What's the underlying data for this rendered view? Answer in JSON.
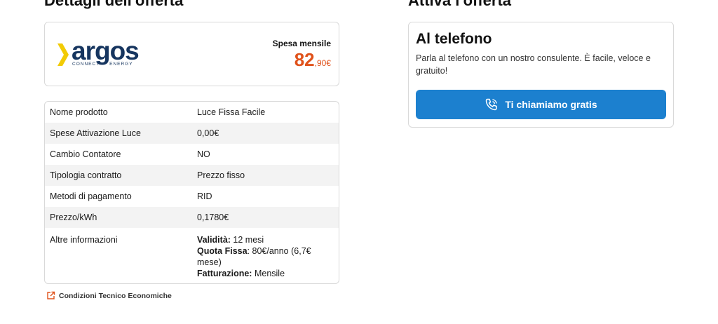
{
  "sections": {
    "left_title": "Dettagli dell'offerta",
    "right_title": "Attiva l'offerta"
  },
  "offer": {
    "logo_text": "argos",
    "logo_sub_left": "CONNECT",
    "logo_sub_right": "ENERGY",
    "spesa_label": "Spesa mensile",
    "price_int": "82",
    "price_dec": ",90€",
    "price_color": "#e0521b"
  },
  "details": {
    "rows": [
      {
        "key": "Nome prodotto",
        "value": "Luce Fissa Facile"
      },
      {
        "key": "Spese Attivazione Luce",
        "value": "0,00€"
      },
      {
        "key": "Cambio Contatore",
        "value": "NO"
      },
      {
        "key": "Tipologia contratto",
        "value": "Prezzo fisso"
      },
      {
        "key": "Metodi di pagamento",
        "value": "RID"
      },
      {
        "key": "Prezzo/kWh",
        "value": "0,1780€"
      }
    ],
    "other": {
      "key": "Altre informazioni",
      "validita_label": "Validità:",
      "validita_value": " 12 mesi",
      "quota_label": "Quota Fissa",
      "quota_value": ":  80€/anno (6,7€ mese)",
      "fatturazione_label": "Fatturazione:",
      "fatturazione_value": " Mensile"
    }
  },
  "conditions_link": "Condizioni Tecnico Economiche",
  "phone": {
    "title": "Al telefono",
    "description": "Parla al telefono con un nostro consulente. È facile, veloce e gratuito!",
    "button_label": "Ti chiamiamo gratis",
    "button_color": "#1c80cf"
  }
}
